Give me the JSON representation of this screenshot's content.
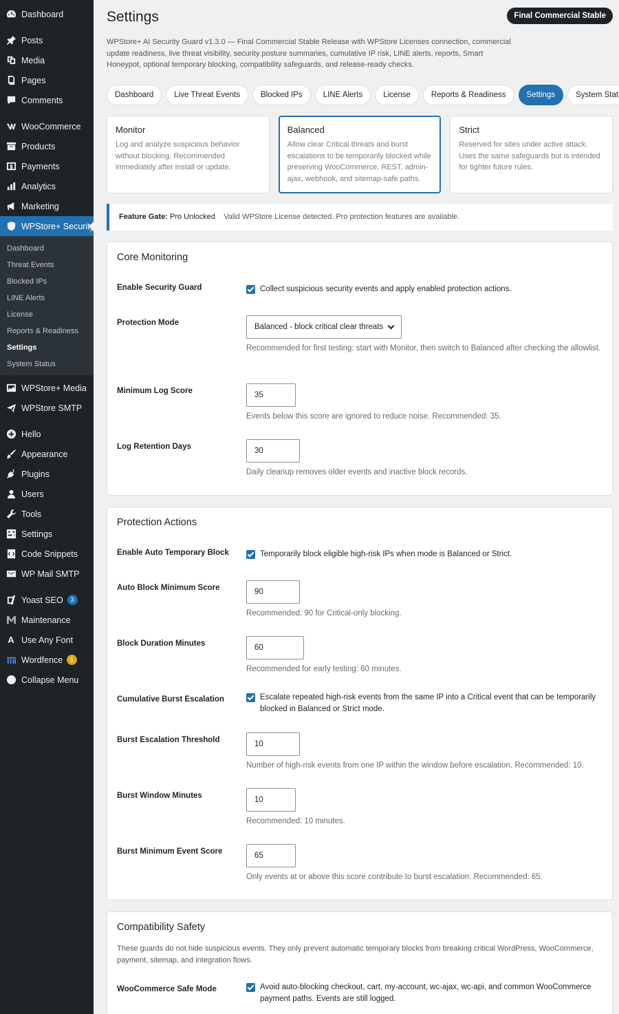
{
  "sidebar": {
    "top_items": [
      {
        "label": "Dashboard",
        "icon": "dashboard-icon"
      },
      {
        "label": "Posts",
        "icon": "pin-icon"
      },
      {
        "label": "Media",
        "icon": "media-icon"
      },
      {
        "label": "Pages",
        "icon": "page-icon"
      },
      {
        "label": "Comments",
        "icon": "comment-icon"
      },
      {
        "label": "WooCommerce",
        "icon": "woocommerce-icon"
      },
      {
        "label": "Products",
        "icon": "archive-icon"
      },
      {
        "label": "Payments",
        "icon": "payments-icon"
      },
      {
        "label": "Analytics",
        "icon": "chart-bar-icon"
      },
      {
        "label": "Marketing",
        "icon": "megaphone-icon"
      },
      {
        "label": "WPStore+ Security",
        "icon": "shield-icon"
      }
    ],
    "submenu": [
      "Dashboard",
      "Threat Events",
      "Blocked IPs",
      "LINE Alerts",
      "License",
      "Reports & Readiness",
      "Settings",
      "System Status"
    ],
    "bottom_items": [
      {
        "label": "WPStore+ Media",
        "icon": "media-library-icon"
      },
      {
        "label": "WPStore SMTP",
        "icon": "send-icon"
      },
      {
        "label": "Hello",
        "icon": "plus-circle-icon"
      },
      {
        "label": "Appearance",
        "icon": "brush-icon"
      },
      {
        "label": "Plugins",
        "icon": "plugin-icon"
      },
      {
        "label": "Users",
        "icon": "user-icon"
      },
      {
        "label": "Tools",
        "icon": "wrench-icon"
      },
      {
        "label": "Settings",
        "icon": "settings-sliders-icon"
      },
      {
        "label": "Code Snippets",
        "icon": "code-icon"
      },
      {
        "label": "WP Mail SMTP",
        "icon": "mail-icon"
      },
      {
        "label": "Yoast SEO",
        "icon": "yoast-icon",
        "badge": "3"
      },
      {
        "label": "Maintenance",
        "icon": "maintenance-icon"
      },
      {
        "label": "Use Any Font",
        "icon": "font-icon"
      },
      {
        "label": "Wordfence",
        "icon": "wordfence-icon",
        "badge": "1"
      },
      {
        "label": "Collapse Menu",
        "icon": "collapse-icon"
      }
    ]
  },
  "header": {
    "title": "Settings",
    "release_badge": "Final Commercial Stable",
    "intro": "WPStore+ AI Security Guard v1.3.0 — Final Commercial Stable Release with WPStore Licenses connection, commercial update readiness, live threat visibility, security posture summaries, cumulative IP risk, LINE alerts, reports, Smart Honeypot, optional temporary blocking, compatibility safeguards, and release-ready checks."
  },
  "tabs": [
    "Dashboard",
    "Live Threat Events",
    "Blocked IPs",
    "LINE Alerts",
    "License",
    "Reports & Readiness",
    "Settings",
    "System Status"
  ],
  "modes": [
    {
      "title": "Monitor",
      "desc": "Log and analyze suspicious behavior without blocking. Recommended immediately after install or update."
    },
    {
      "title": "Balanced",
      "desc": "Allow clear Critical threats and burst escalations to be temporarily blocked while preserving WooCommerce, REST, admin-ajax, webhook, and sitemap-safe paths."
    },
    {
      "title": "Strict",
      "desc": "Reserved for sites under active attack. Uses the same safeguards but is intended for tighter future rules."
    }
  ],
  "notice": {
    "label": "Feature Gate:",
    "status": "Pro Unlocked",
    "message": "Valid WPStore License detected. Pro protection features are available."
  },
  "core": {
    "title": "Core Monitoring",
    "enable_label": "Enable Security Guard",
    "enable_text": "Collect suspicious security events and apply enabled protection actions.",
    "mode_label": "Protection Mode",
    "mode_value": "Balanced - block critical clear threats",
    "mode_help": "Recommended for first testing: start with Monitor, then switch to Balanced after checking the allowlist.",
    "min_score_label": "Minimum Log Score",
    "min_score_value": "35",
    "min_score_help": "Events below this score are ignored to reduce noise. Recommended: 35.",
    "retention_label": "Log Retention Days",
    "retention_value": "30",
    "retention_help": "Daily cleanup removes older events and inactive block records."
  },
  "actions": {
    "title": "Protection Actions",
    "auto_block_label": "Enable Auto Temporary Block",
    "auto_block_text": "Temporarily block eligible high-risk IPs when mode is Balanced or Strict.",
    "auto_min_label": "Auto Block Minimum Score",
    "auto_min_value": "90",
    "auto_min_help": "Recommended: 90 for Critical-only blocking.",
    "duration_label": "Block Duration Minutes",
    "duration_value": "60",
    "duration_help": "Recommended for early testing: 60 minutes.",
    "burst_label": "Cumulative Burst Escalation",
    "burst_text": "Escalate repeated high-risk events from the same IP into a Critical event that can be temporarily blocked in Balanced or Strict mode.",
    "threshold_label": "Burst Escalation Threshold",
    "threshold_value": "10",
    "threshold_help": "Number of high-risk events from one IP within the window before escalation. Recommended: 10.",
    "window_label": "Burst Window Minutes",
    "window_value": "10",
    "window_help": "Recommended: 10 minutes.",
    "min_event_label": "Burst Minimum Event Score",
    "min_event_value": "65",
    "min_event_help": "Only events at or above this score contribute to burst escalation. Recommended: 65."
  },
  "compat": {
    "title": "Compatibility Safety",
    "intro": "These guards do not hide suspicious events. They only prevent automatic temporary blocks from breaking critical WordPress, WooCommerce, payment, sitemap, and integration flows.",
    "woo_label": "WooCommerce Safe Mode",
    "woo_text": "Avoid auto-blocking checkout, cart, my-account, wc-ajax, wc-api, and common WooCommerce payment paths. Events are still logged."
  }
}
